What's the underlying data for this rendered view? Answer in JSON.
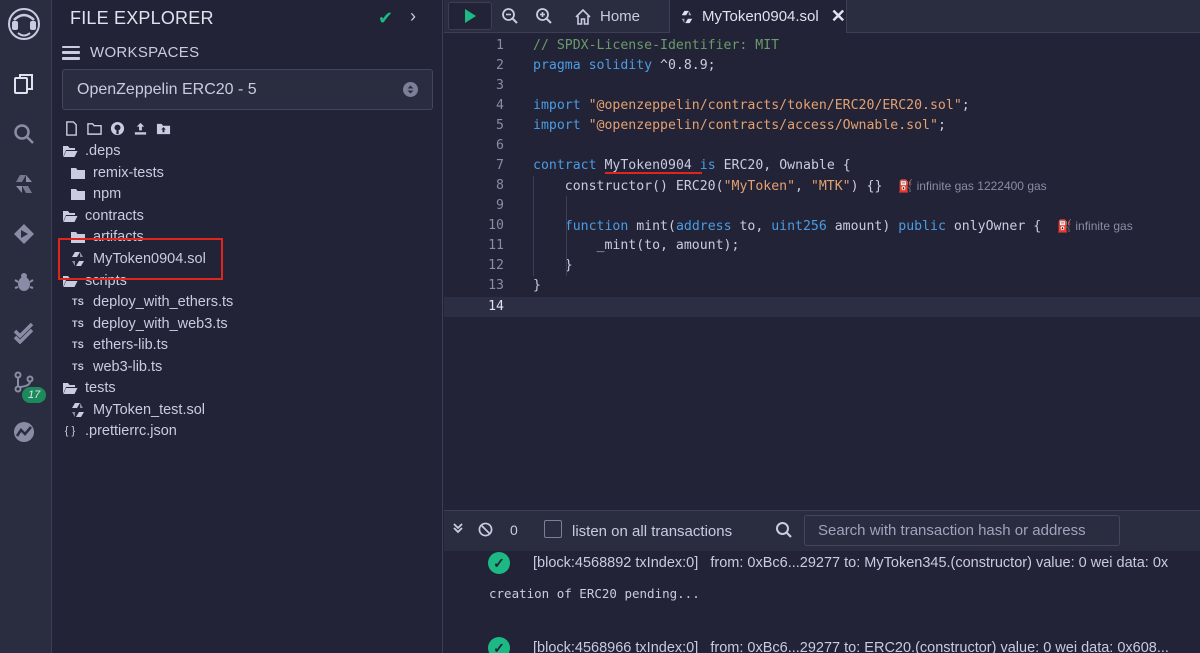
{
  "rail": {
    "badge_count": "17"
  },
  "explorer": {
    "title": "FILE EXPLORER",
    "workspaces_label": "WORKSPACES",
    "workspace_selected": "OpenZeppelin ERC20 - 5",
    "tree": [
      {
        "label": ".deps",
        "kind": "folder-open"
      },
      {
        "label": "remix-tests",
        "kind": "folder"
      },
      {
        "label": "npm",
        "kind": "folder"
      },
      {
        "label": "contracts",
        "kind": "folder-open"
      },
      {
        "label": "artifacts",
        "kind": "folder"
      },
      {
        "label": "MyToken0904.sol",
        "kind": "sol"
      },
      {
        "label": "scripts",
        "kind": "folder-open"
      },
      {
        "label": "deploy_with_ethers.ts",
        "kind": "ts"
      },
      {
        "label": "deploy_with_web3.ts",
        "kind": "ts"
      },
      {
        "label": "ethers-lib.ts",
        "kind": "ts"
      },
      {
        "label": "web3-lib.ts",
        "kind": "ts"
      },
      {
        "label": "tests",
        "kind": "folder-open"
      },
      {
        "label": "MyToken_test.sol",
        "kind": "sol"
      },
      {
        "label": ".prettierrc.json",
        "kind": "json"
      }
    ],
    "ts_badge": "TS",
    "json_badge": "{ }"
  },
  "tabs": {
    "home": "Home",
    "active": "MyToken0904.sol"
  },
  "code": {
    "line_numbers": [
      "1",
      "2",
      "3",
      "4",
      "5",
      "6",
      "7",
      "8",
      "9",
      "10",
      "11",
      "12",
      "13",
      "14"
    ],
    "l1": "// SPDX-License-Identifier: MIT",
    "l2_kw": "pragma solidity",
    "l2_rest": " ^0.8.9;",
    "l4_kw": "import",
    "l4_str": "\"@openzeppelin/contracts/token/ERC20/ERC20.sol\"",
    "l5_kw": "import",
    "l5_str": "\"@openzeppelin/contracts/access/Ownable.sol\"",
    "semicolon": ";",
    "l7_kw": "contract",
    "l7_name": "MyToken0904",
    "l7_is": "is",
    "l7_rest": " ERC20, Ownable {",
    "l8_a": "    constructor() ERC20(",
    "l8_s1": "\"MyToken\"",
    "l8_b": ", ",
    "l8_s2": "\"MTK\"",
    "l8_c": ") {}",
    "l8_gas": "infinite gas 1222400 gas",
    "l10_kw": "function",
    "l10_a": " mint(",
    "l10_t1": "address",
    "l10_b": " to, ",
    "l10_t2": "uint256",
    "l10_c": " amount) ",
    "l10_pub": "public",
    "l10_d": " onlyOwner {",
    "l10_gas": "infinite gas",
    "l11": "        _mint(to, amount);",
    "l12": "    }",
    "l13": "}"
  },
  "terminal": {
    "count": "0",
    "listen_label": "listen on all transactions",
    "search_placeholder": "Search with transaction hash or address",
    "log1_block": "[block:4568892 txIndex:0]",
    "log1_detail": "from: 0xBc6...29277 to: MyToken345.(constructor) value: 0 wei data: 0x",
    "log_pending": "creation of ERC20 pending...",
    "log2_block": "[block:4568966 txIndex:0]",
    "log2_detail": "from: 0xBc6...29277 to: ERC20.(constructor) value: 0 wei data: 0x608..."
  }
}
